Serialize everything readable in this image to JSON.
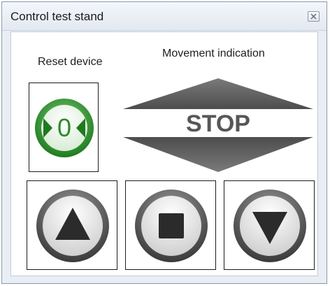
{
  "window": {
    "title": "Control test stand",
    "close_icon": "close-icon"
  },
  "reset": {
    "label": "Reset device",
    "glyph": "0",
    "accent": "#3e9b3a"
  },
  "movement": {
    "label": "Movement indication",
    "status": "STOP",
    "color": "#5a5a5a"
  },
  "controls": [
    {
      "name": "up-button",
      "icon": "triangle-up-icon"
    },
    {
      "name": "stop-button",
      "icon": "square-stop-icon"
    },
    {
      "name": "down-button",
      "icon": "triangle-down-icon"
    }
  ]
}
